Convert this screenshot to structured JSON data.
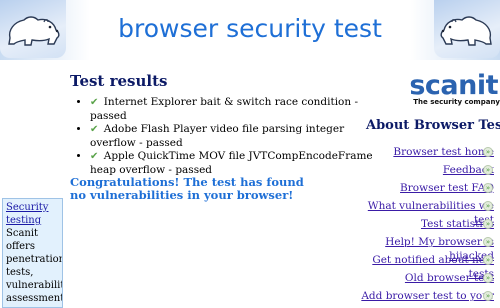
{
  "header": {
    "title": "browser security test",
    "left_logo_icon": "polar-bear-icon",
    "right_logo_icon": "polar-bear-icon",
    "accent_color": "#1e6fd6"
  },
  "results": {
    "heading": "Test results",
    "check_icon": "✔",
    "items": [
      "Internet Explorer bait & switch race condition - passed",
      "Adobe Flash Player video file parsing integer overflow - passed",
      "Apple QuickTime MOV file JVTCompEncodeFrame heap overflow - passed"
    ],
    "congrats": "Congratulations! The test has found no vulnerabilities in your browser!"
  },
  "promo": {
    "link": "Security testing",
    "text": "Scanit offers penetration tests, vulnerability assessments"
  },
  "sidebar": {
    "logo_word": "scanit",
    "logo_tagline": "The security company",
    "heading": "About Browser Test",
    "bullet_glyph": "»",
    "items": [
      "Browser test home",
      "Feedback",
      "Browser test FAQ",
      "What vulnerabilities we test",
      "Test statistics",
      "Help! My browser is hijacked",
      "Get notified about new tests",
      "Old browser test",
      "Add browser test to your"
    ]
  }
}
